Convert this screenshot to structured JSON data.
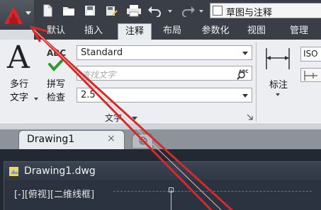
{
  "qat": {
    "app_menu_icon": "autocad-logo-icon",
    "icons": [
      "new-file-icon",
      "open-folder-icon",
      "save-icon",
      "save-as-icon",
      "print-icon",
      "undo-icon",
      "redo-icon"
    ],
    "workspace": "草图与注释"
  },
  "tabs": [
    {
      "label": "默认",
      "active": false
    },
    {
      "label": "插入",
      "active": false
    },
    {
      "label": "注释",
      "active": true
    },
    {
      "label": "布局",
      "active": false
    },
    {
      "label": "参数化",
      "active": false
    },
    {
      "label": "视图",
      "active": false
    },
    {
      "label": "管理",
      "active": false
    }
  ],
  "ribbon": {
    "multiline_text": {
      "glyph": "A",
      "line1": "多行",
      "line2": "文字"
    },
    "spell_check": {
      "abc": "ABC",
      "line1": "拼写",
      "line2": "检查"
    },
    "text_style": {
      "value": "Standard"
    },
    "find_text": {
      "placeholder": "查找文字"
    },
    "text_height": {
      "value": "2.5"
    },
    "panel_title": "文字",
    "dimension": {
      "label": "标注"
    },
    "dim_style": {
      "value": "ISO"
    }
  },
  "file_tabs": {
    "active": {
      "label": "Drawing1",
      "close": "×"
    },
    "new_tab_symbol": "+"
  },
  "drawing": {
    "window_title": "Drawing1.dwg",
    "viewport_label": "[-][俯视][二维线框]"
  },
  "colors": {
    "annotation_arrow": "#d42a2a",
    "ribbon_bg": "#eceef1",
    "tab_bar": "#3a3f47",
    "drawing_bg": "#222933"
  }
}
